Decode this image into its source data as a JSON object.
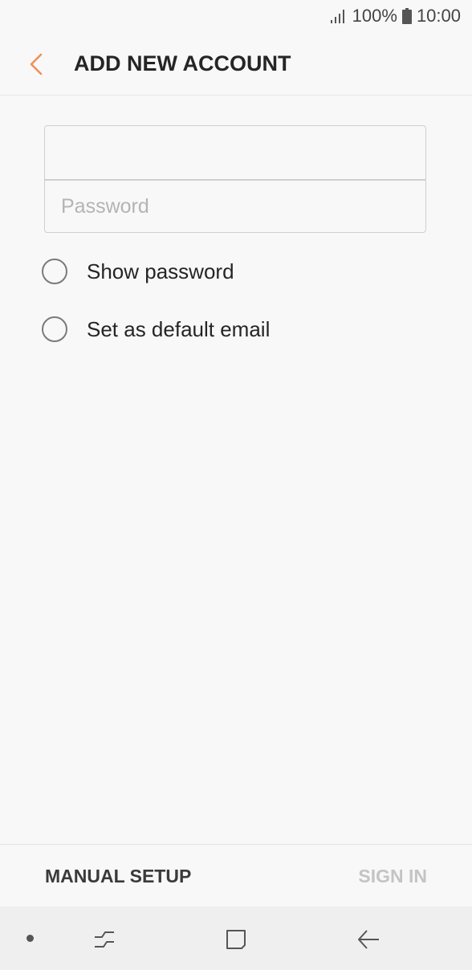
{
  "status_bar": {
    "battery": "100%",
    "time": "10:00",
    "icons": [
      "signal-icon",
      "battery-icon"
    ]
  },
  "app_bar": {
    "title": "ADD NEW ACCOUNT",
    "back_icon": "chevron-left-icon",
    "accent_color": "#f0905a"
  },
  "form": {
    "email_value": "",
    "email_placeholder": "",
    "password_value": "",
    "password_placeholder": "Password"
  },
  "options": {
    "show_password": "Show password",
    "default_email": "Set as default email"
  },
  "bottom_bar": {
    "manual_setup": "MANUAL SETUP",
    "sign_in": "SIGN IN"
  },
  "nav_bar": {
    "icons": [
      "nav-dot",
      "recent-apps-icon",
      "home-icon",
      "back-arrow-icon"
    ]
  }
}
